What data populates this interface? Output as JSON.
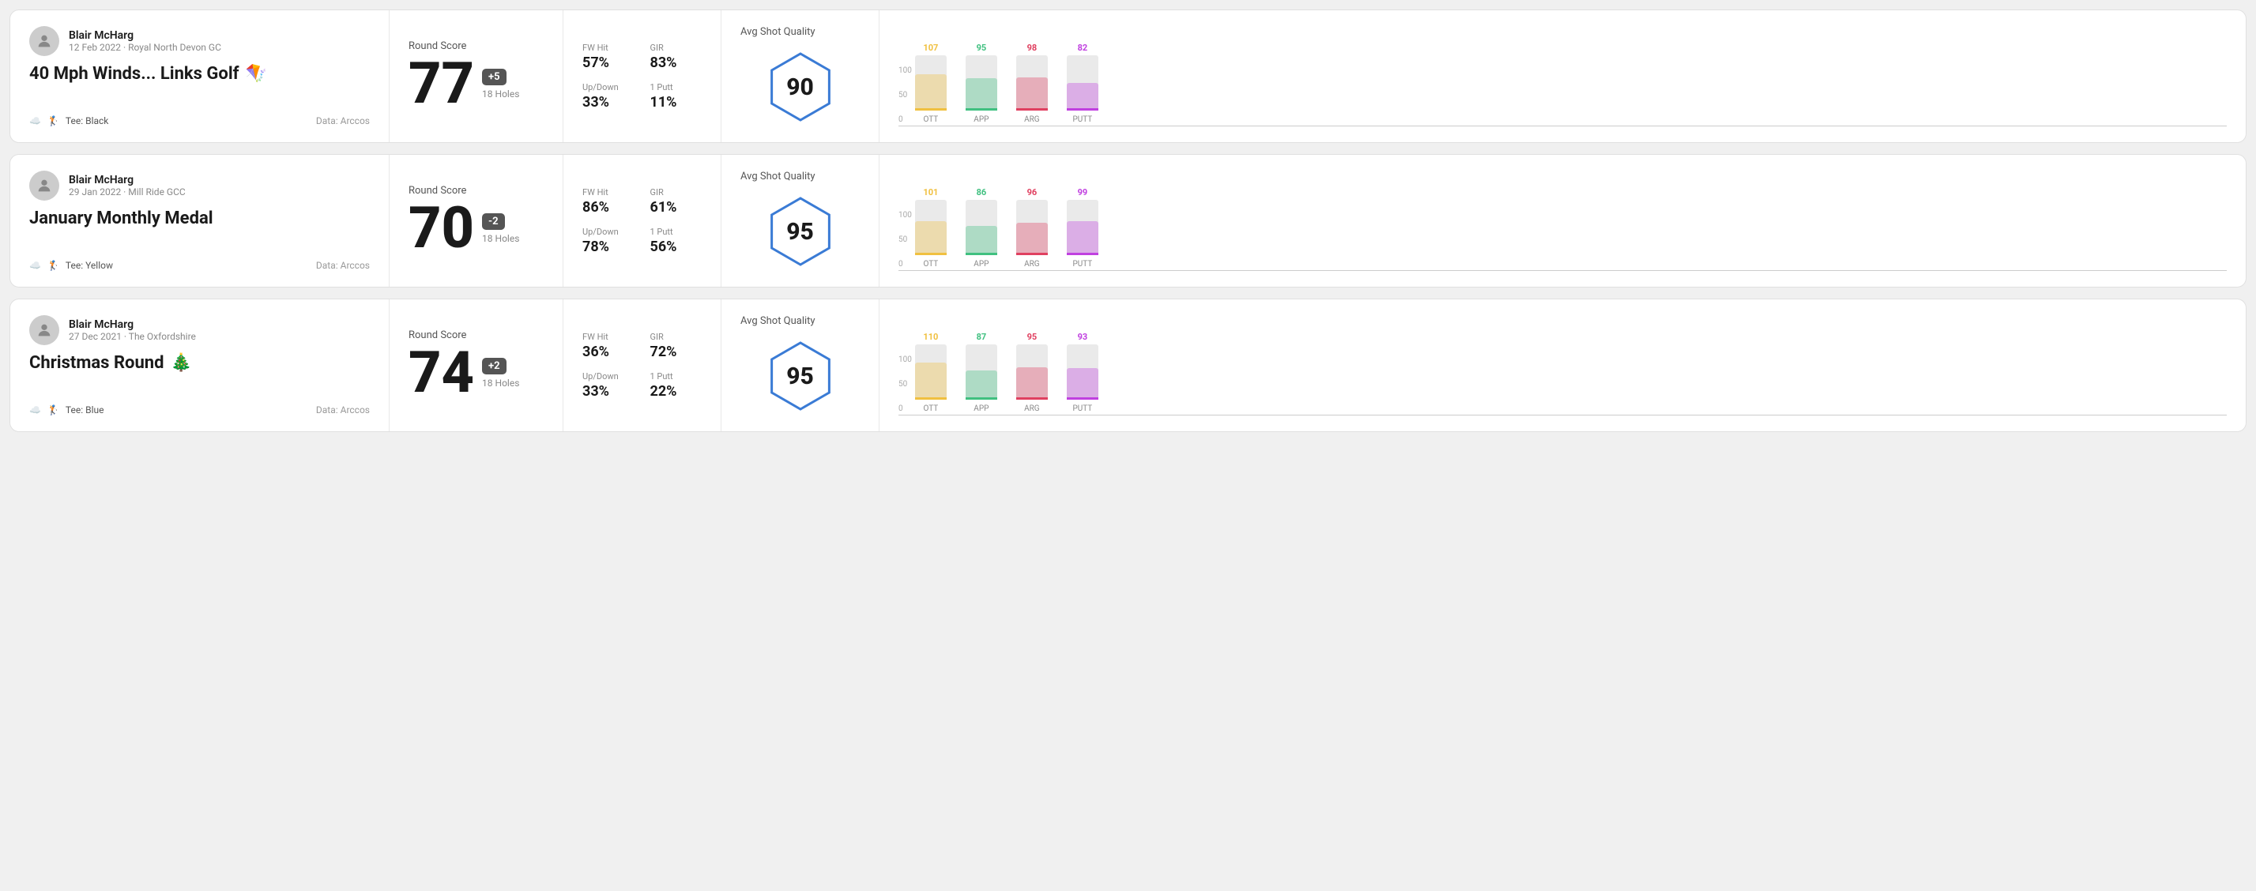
{
  "rounds": [
    {
      "id": "round-1",
      "player": "Blair McHarg",
      "date": "12 Feb 2022 · Royal North Devon GC",
      "title": "40 Mph Winds... Links Golf",
      "title_emoji": "🪁",
      "tee": "Black",
      "data_source": "Data: Arccos",
      "score": "77",
      "score_diff": "+5",
      "score_diff_type": "positive",
      "holes": "18 Holes",
      "fw_hit": "57%",
      "gir": "83%",
      "up_down": "33%",
      "one_putt": "11%",
      "avg_quality": "90",
      "chart": {
        "ott": {
          "value": 107,
          "color": "#f0c040",
          "pct": 65
        },
        "app": {
          "value": 95,
          "color": "#40c080",
          "pct": 58
        },
        "arg": {
          "value": 98,
          "color": "#e04060",
          "pct": 60
        },
        "putt": {
          "value": 82,
          "color": "#c040e0",
          "pct": 50
        }
      }
    },
    {
      "id": "round-2",
      "player": "Blair McHarg",
      "date": "29 Jan 2022 · Mill Ride GCC",
      "title": "January Monthly Medal",
      "title_emoji": "",
      "tee": "Yellow",
      "data_source": "Data: Arccos",
      "score": "70",
      "score_diff": "-2",
      "score_diff_type": "negative",
      "holes": "18 Holes",
      "fw_hit": "86%",
      "gir": "61%",
      "up_down": "78%",
      "one_putt": "56%",
      "avg_quality": "95",
      "chart": {
        "ott": {
          "value": 101,
          "color": "#f0c040",
          "pct": 62
        },
        "app": {
          "value": 86,
          "color": "#40c080",
          "pct": 53
        },
        "arg": {
          "value": 96,
          "color": "#e04060",
          "pct": 59
        },
        "putt": {
          "value": 99,
          "color": "#c040e0",
          "pct": 61
        }
      }
    },
    {
      "id": "round-3",
      "player": "Blair McHarg",
      "date": "27 Dec 2021 · The Oxfordshire",
      "title": "Christmas Round",
      "title_emoji": "🎄",
      "tee": "Blue",
      "data_source": "Data: Arccos",
      "score": "74",
      "score_diff": "+2",
      "score_diff_type": "positive",
      "holes": "18 Holes",
      "fw_hit": "36%",
      "gir": "72%",
      "up_down": "33%",
      "one_putt": "22%",
      "avg_quality": "95",
      "chart": {
        "ott": {
          "value": 110,
          "color": "#f0c040",
          "pct": 67
        },
        "app": {
          "value": 87,
          "color": "#40c080",
          "pct": 53
        },
        "arg": {
          "value": 95,
          "color": "#e04060",
          "pct": 58
        },
        "putt": {
          "value": 93,
          "color": "#c040e0",
          "pct": 57
        }
      }
    }
  ],
  "labels": {
    "round_score": "Round Score",
    "fw_hit": "FW Hit",
    "gir": "GIR",
    "up_down": "Up/Down",
    "one_putt": "1 Putt",
    "avg_shot_quality": "Avg Shot Quality",
    "ott": "OTT",
    "app": "APP",
    "arg": "ARG",
    "putt": "PUTT",
    "y100": "100",
    "y50": "50",
    "y0": "0"
  }
}
